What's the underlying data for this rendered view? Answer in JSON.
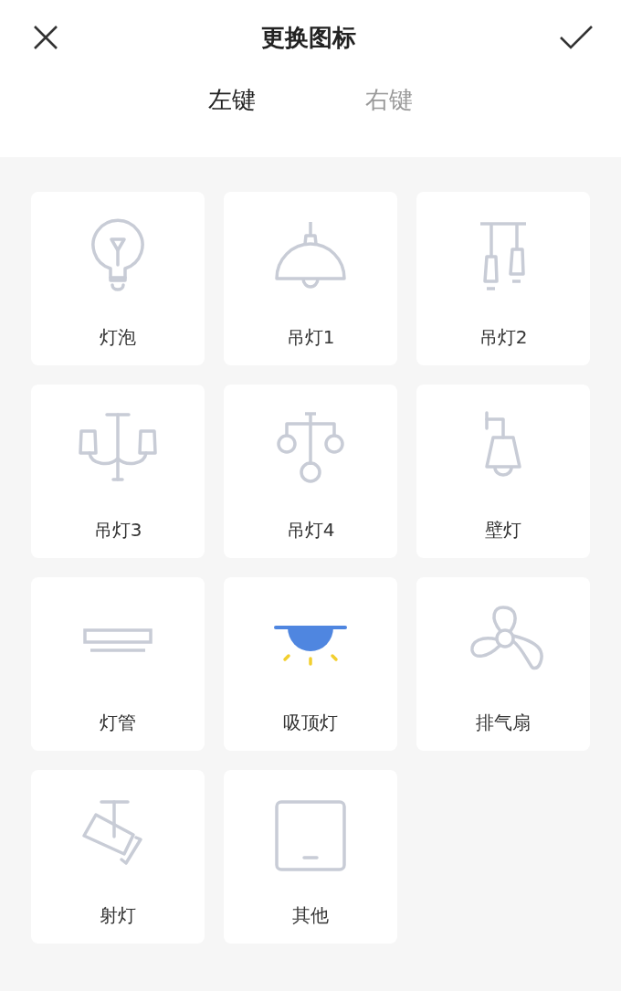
{
  "header": {
    "title": "更换图标"
  },
  "tabs": [
    {
      "label": "左键",
      "selected": true
    },
    {
      "label": "右键",
      "selected": false
    }
  ],
  "icons": [
    {
      "label": "灯泡",
      "kind": "bulb",
      "selected": false
    },
    {
      "label": "吊灯1",
      "kind": "pendant1",
      "selected": false
    },
    {
      "label": "吊灯2",
      "kind": "pendant2",
      "selected": false
    },
    {
      "label": "吊灯3",
      "kind": "pendant3",
      "selected": false
    },
    {
      "label": "吊灯4",
      "kind": "pendant4",
      "selected": false
    },
    {
      "label": "壁灯",
      "kind": "wall",
      "selected": false
    },
    {
      "label": "灯管",
      "kind": "tube",
      "selected": false
    },
    {
      "label": "吸顶灯",
      "kind": "ceiling",
      "selected": true
    },
    {
      "label": "排气扇",
      "kind": "fan",
      "selected": false
    },
    {
      "label": "射灯",
      "kind": "spot",
      "selected": false
    },
    {
      "label": "其他",
      "kind": "other",
      "selected": false
    }
  ]
}
